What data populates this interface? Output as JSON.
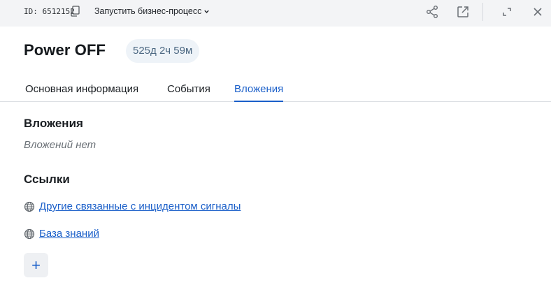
{
  "topbar": {
    "id_label": "ID: 6512152",
    "business_process_label": "Запустить бизнес-процесс"
  },
  "header": {
    "title": "Power OFF",
    "timer": "525д 2ч 59м"
  },
  "tabs": [
    {
      "label": "Основная информация",
      "active": false
    },
    {
      "label": "События",
      "active": false
    },
    {
      "label": "Вложения",
      "active": true
    }
  ],
  "attachments": {
    "title": "Вложения",
    "empty_text": "Вложений нет"
  },
  "links": {
    "title": "Ссылки",
    "items": [
      {
        "label": "Другие связанные с инцидентом сигналы",
        "icon": "globe-icon"
      },
      {
        "label": "База знаний",
        "icon": "globe-icon"
      }
    ],
    "add_label": "+"
  },
  "colors": {
    "accent": "#1a5fc9",
    "topbar_bg": "#f3f4f6",
    "badge_bg": "#eef3f8"
  }
}
